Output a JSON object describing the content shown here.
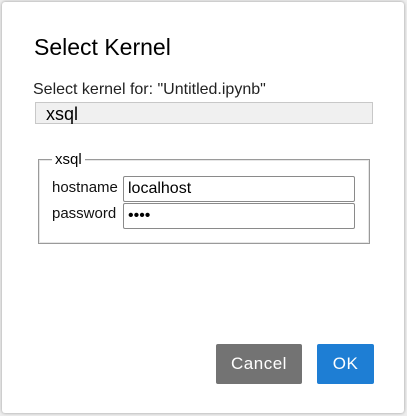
{
  "dialog": {
    "title": "Select Kernel",
    "kernel_label": "Select kernel for: \"Untitled.ipynb\"",
    "kernel_selected": "xsql"
  },
  "form": {
    "legend": "xsql",
    "hostname_label": "hostname",
    "hostname_value": "localhost",
    "password_label": "password",
    "password_value": "••••"
  },
  "buttons": {
    "cancel_label": "Cancel",
    "ok_label": "OK"
  },
  "colors": {
    "cancel_bg": "#737373",
    "ok_bg": "#1e7ed4"
  }
}
